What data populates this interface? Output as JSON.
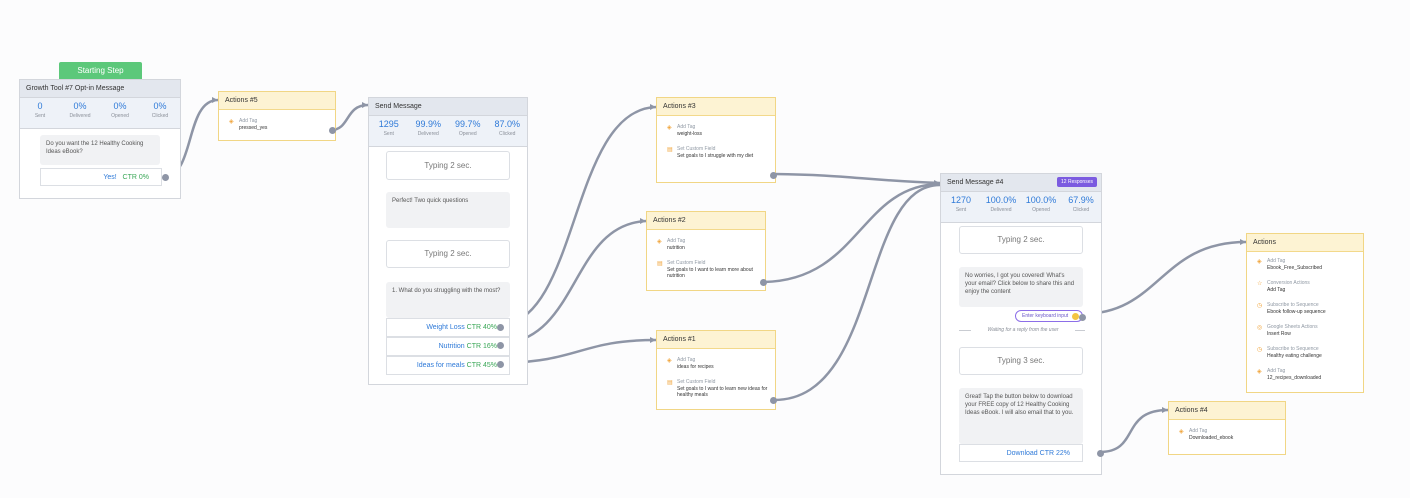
{
  "starting_step": {
    "label": "Starting Step"
  },
  "growth_tool": {
    "title": "Growth Tool #7 Opt-in Message",
    "stats": [
      {
        "value": "0",
        "label": "Sent"
      },
      {
        "value": "0%",
        "label": "Delivered"
      },
      {
        "value": "0%",
        "label": "Opened"
      },
      {
        "value": "0%",
        "label": "Clicked"
      }
    ],
    "message": "Do you want the 12 Healthy Cooking Ideas eBook?",
    "button": {
      "label": "Yes!",
      "ctr": "CTR 0%"
    }
  },
  "actions5": {
    "title": "Actions #5",
    "rows": [
      {
        "type": "Add Tag",
        "value": "pressed_yes"
      }
    ]
  },
  "send_message": {
    "title": "Send Message",
    "stats": [
      {
        "value": "1295",
        "label": "Sent"
      },
      {
        "value": "99.9%",
        "label": "Delivered"
      },
      {
        "value": "99.7%",
        "label": "Opened"
      },
      {
        "value": "87.0%",
        "label": "Clicked"
      }
    ],
    "typing1": "Typing 2 sec.",
    "msg1": "Perfect! Two quick questions",
    "typing2": "Typing 2 sec.",
    "question": "1. What do you struggling with the most?",
    "buttons": [
      {
        "label": "Weight Loss",
        "ctr": "CTR 40%"
      },
      {
        "label": "Nutrition",
        "ctr": "CTR 16%"
      },
      {
        "label": "Ideas for meals",
        "ctr": "CTR 45%"
      }
    ]
  },
  "actions3": {
    "title": "Actions #3",
    "rows": [
      {
        "type": "Add Tag",
        "value": "weight-loss"
      },
      {
        "type": "Set Custom Field",
        "value": "Set goals to I struggle with my diet"
      }
    ]
  },
  "actions2": {
    "title": "Actions #2",
    "rows": [
      {
        "type": "Add Tag",
        "value": "nutrition"
      },
      {
        "type": "Set Custom Field",
        "value": "Set goals to I want to learn more about nutrition"
      }
    ]
  },
  "actions1": {
    "title": "Actions #1",
    "rows": [
      {
        "type": "Add Tag",
        "value": "ideas for recipes"
      },
      {
        "type": "Set Custom Field",
        "value": "Set goals to I want to learn new ideas for healthy meals"
      }
    ]
  },
  "send_message4": {
    "title": "Send Message #4",
    "badge": "12 Responses",
    "stats": [
      {
        "value": "1270",
        "label": "Sent"
      },
      {
        "value": "100.0%",
        "label": "Delivered"
      },
      {
        "value": "100.0%",
        "label": "Opened"
      },
      {
        "value": "67.9%",
        "label": "Clicked"
      }
    ],
    "typing1": "Typing 2 sec.",
    "msg1": "No worries, I got you covered! What's your email? Click below to share this and enjoy the content",
    "keyboard": "Enter keyboard input",
    "waiting": "Waiting for a reply from the user",
    "typing2": "Typing 3 sec.",
    "msg2": "Great! Tap the button below to download your FREE copy of 12 Healthy Cooking Ideas eBook. I will also email that to you.",
    "button": {
      "label": "Download",
      "ctr": "CTR 22%"
    }
  },
  "actions": {
    "title": "Actions",
    "rows": [
      {
        "type": "Add Tag",
        "value": "Ebook_Free_Subscribed"
      },
      {
        "type": "Conversion Actions",
        "value": "Add Tag"
      },
      {
        "type": "Subscribe to Sequence",
        "value": "Ebook follow-up sequence"
      },
      {
        "type": "Google Sheets Actions",
        "value": "Insert Row"
      },
      {
        "type": "Subscribe to Sequence",
        "value": "Healthy eating challenge"
      },
      {
        "type": "Add Tag",
        "value": "12_recipes_downloaded"
      }
    ]
  },
  "actions4": {
    "title": "Actions #4",
    "rows": [
      {
        "type": "Add Tag",
        "value": "Downloaded_ebook"
      }
    ]
  },
  "colors": {
    "link": "#2f7ad8",
    "ctr": "#3aa757",
    "edge": "#8e95a6",
    "starting": "#5cc87a",
    "badge": "#7b5be0",
    "action_header": "#fdf3d3"
  }
}
